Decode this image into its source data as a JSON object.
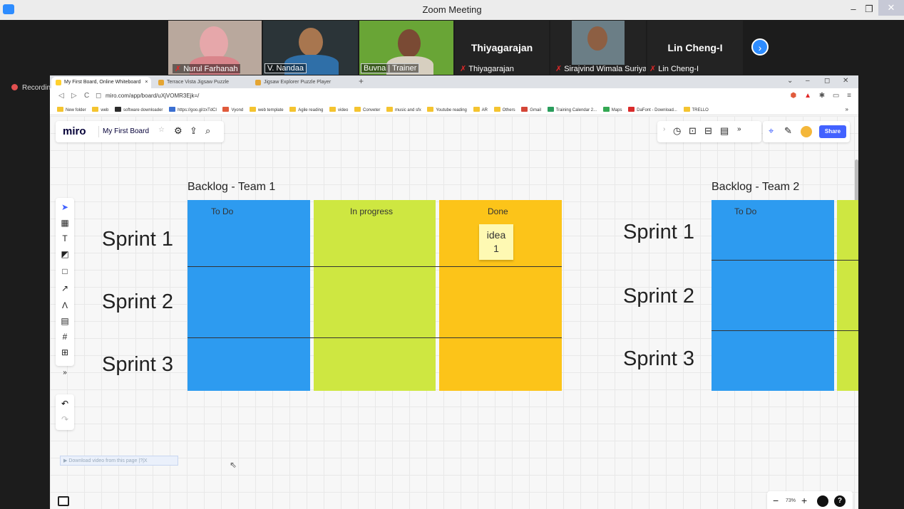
{
  "zoom": {
    "window_title": "Zoom Meeting",
    "recording_label": "Recordin",
    "minimize": "–",
    "maximize": "❐",
    "close": "✕",
    "next": "›"
  },
  "participants": [
    {
      "name": "Nurul Farhanah",
      "muted": true
    },
    {
      "name": "V. Nandaa",
      "muted": false
    },
    {
      "name": "Buvna | Trainer",
      "muted": false
    },
    {
      "name": "Thiyagarajan",
      "display": "Thiyagarajan",
      "muted": true
    },
    {
      "name": "Sirajvind Wimala Suriya",
      "muted": true
    },
    {
      "name": "Lin Cheng-I",
      "display": "Lin Cheng-I",
      "muted": true
    }
  ],
  "browser": {
    "tabs": [
      {
        "title": "My First Board, Online Whiteboard",
        "close": "×",
        "active": true
      },
      {
        "title": "Terrace Vista Jigsaw Puzzle",
        "active": false
      },
      {
        "title": "Jigsaw Explorer Puzzle Player",
        "active": false
      }
    ],
    "new_tab": "+",
    "tab_ctrls": {
      "dropdown": "⌄",
      "min": "–",
      "restore": "◻",
      "close": "✕"
    },
    "nav": {
      "back": "◁",
      "forward": "▷",
      "reload": "C",
      "bookmark": "◻"
    },
    "url": "miro.com/app/board/uXjVOMR3Ejk=/",
    "addr_icons": [
      "⬢",
      "▲",
      "✱",
      "▭",
      "≡"
    ],
    "bookmarks": [
      "New folder",
      "web",
      "software downloader",
      "https://goo.gl/zxTdCl",
      "Vyond",
      "web template",
      "Agile reading",
      "video",
      "Conveter",
      "music and sfx",
      "Youtube reading",
      "AR",
      "Others",
      "Gmail",
      "Training Calendar 2...",
      "Maps",
      "DaFont - Download...",
      "TRELLO"
    ],
    "bookmarks_more": "»"
  },
  "miro": {
    "logo": "miro",
    "board_name": "My First Board",
    "star": "☆",
    "toolbar_icons": {
      "settings": "⚙",
      "upload": "⇪",
      "search": "⌕"
    },
    "right_icons": [
      "›",
      "◷",
      "⊡",
      "⊟",
      "▤",
      "»"
    ],
    "collab_icons": [
      "⌖",
      "✎"
    ],
    "share": "Share",
    "tools": [
      "➤",
      "▦",
      "T",
      "◩",
      "□",
      "↗",
      "Λ",
      "▤",
      "#",
      "⊞",
      "»"
    ],
    "undo": "↶",
    "redo": "↷",
    "zoom_minus": "−",
    "zoom_level": "73%",
    "zoom_plus": "+",
    "help": "?",
    "download_ext": "▶ Download video from this page  |?|X",
    "cursor": "⇖",
    "frame1": {
      "title": "Backlog - Team 1",
      "columns": [
        "To Do",
        "In progress",
        "Done"
      ],
      "rows": [
        "Sprint 1",
        "Sprint 2",
        "Sprint 3"
      ],
      "sticky": {
        "line1": "idea",
        "line2": "1"
      }
    },
    "frame2": {
      "title": "Backlog - Team 2",
      "columns": [
        "To Do"
      ],
      "rows": [
        "Sprint 1",
        "Sprint 2",
        "Sprint 3"
      ]
    }
  }
}
